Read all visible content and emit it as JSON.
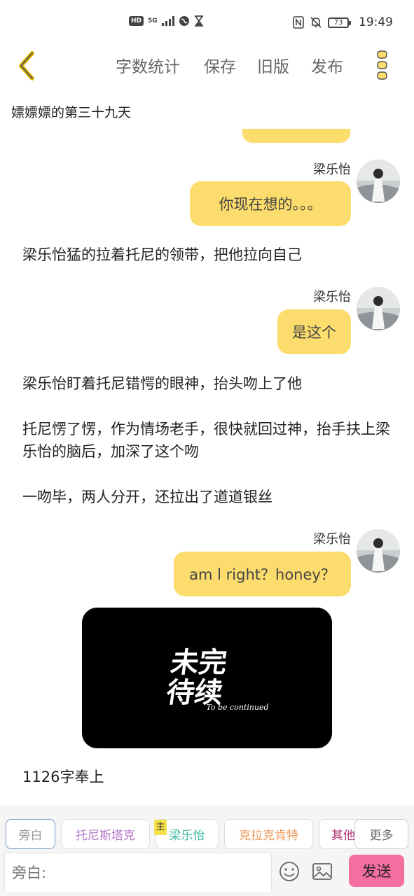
{
  "status_bar": {
    "hd": "HD",
    "network": "5G",
    "battery": "73",
    "time": "19:49"
  },
  "toolbar": {
    "word_count": "字数统计",
    "save": "保存",
    "old_version": "旧版",
    "publish": "发布"
  },
  "doc_title": "嫖嫖嫖的第三十九天",
  "messages": [
    {
      "speaker": "梁乐怡",
      "text": "你现在想的。。。"
    },
    {
      "narration": "梁乐怡猛的拉着托尼的领带，把他拉向自己"
    },
    {
      "speaker": "梁乐怡",
      "text": "是这个"
    },
    {
      "narration": "梁乐怡盯着托尼错愕的眼神，抬头吻上了他"
    },
    {
      "narration": "托尼愣了愣，作为情场老手，很快就回过神，抬手扶上梁乐怡的脑后，加深了这个吻"
    },
    {
      "narration": "一吻毕，两人分开，还拉出了道道银丝"
    },
    {
      "speaker": "梁乐怡",
      "text": "am l right？honey？"
    },
    {
      "narration": "1126字奉上"
    }
  ],
  "tbc_image": {
    "line1": "未完",
    "line2": "待续",
    "subtitle": "To be continued"
  },
  "roles": [
    {
      "label": "旁白",
      "color": "#999999"
    },
    {
      "label": "托尼斯塔克",
      "color": "#b477c9"
    },
    {
      "label": "梁乐怡",
      "color": "#3fb9a6"
    },
    {
      "label": "克拉克肯特",
      "color": "#ef9a5c"
    },
    {
      "label": "其他",
      "color": "#b03a7a"
    }
  ],
  "main_tag": "主",
  "more_label": "更多",
  "input": {
    "placeholder": "旁白:"
  },
  "send_label": "发送",
  "icons": {
    "back": "chevron-left-icon",
    "menu": "more-vertical-icon",
    "emoji": "emoji-icon",
    "image": "image-icon"
  },
  "colors": {
    "bubble": "#fbdc6c",
    "accent_back": "#e3b800",
    "send": "#f56ea0"
  }
}
